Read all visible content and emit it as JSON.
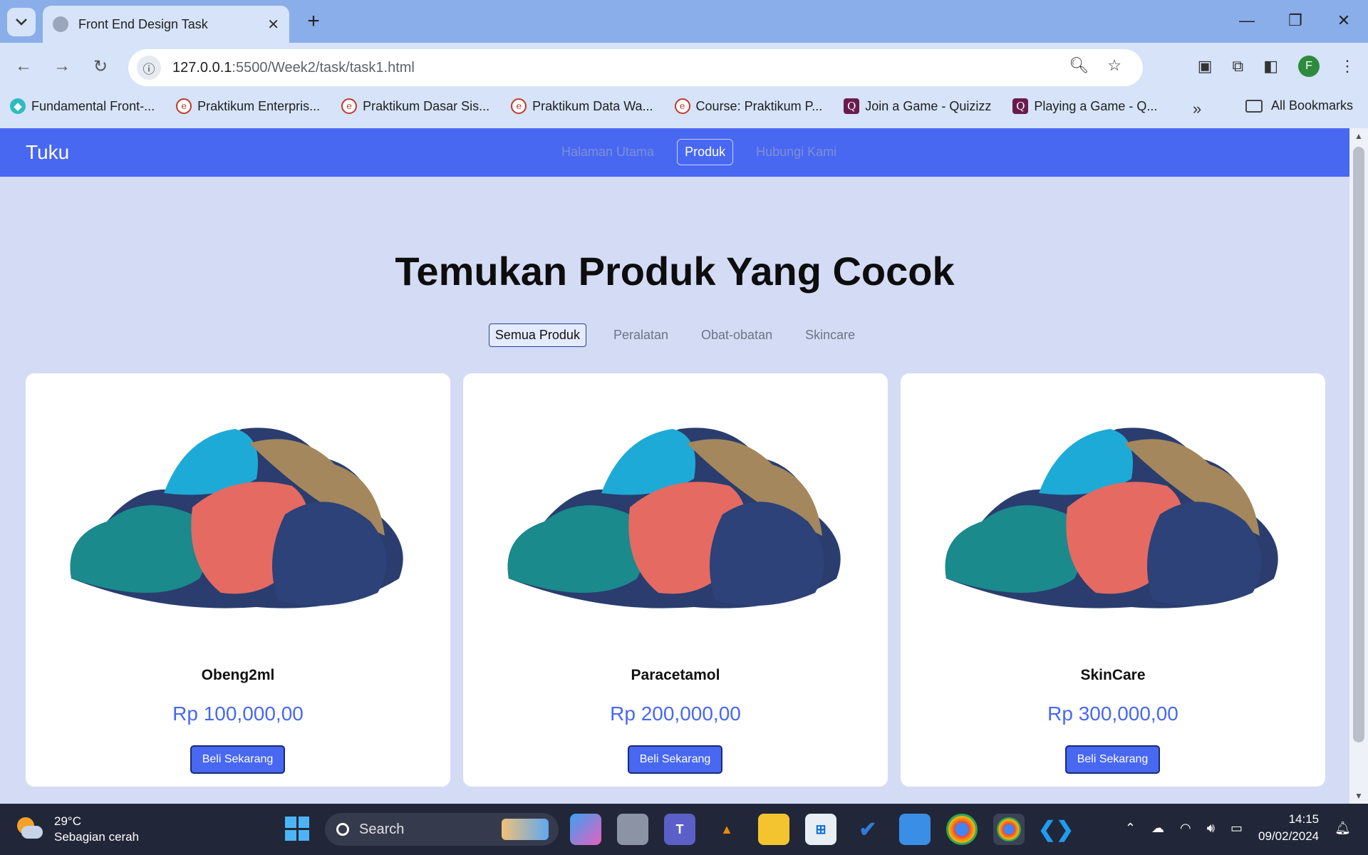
{
  "browser": {
    "tab_title": "Front End Design Task",
    "new_tab_label": "+",
    "url_host": "127.0.0.1",
    "url_path": ":5500/Week2/task/task1.html",
    "profile_initial": "F",
    "bookmarks": [
      {
        "label": "Fundamental Front-...",
        "icon": "fundamental-icon"
      },
      {
        "label": "Praktikum Enterpris...",
        "icon": "e-learning-icon"
      },
      {
        "label": "Praktikum Dasar Sis...",
        "icon": "e-learning-icon"
      },
      {
        "label": "Praktikum Data Wa...",
        "icon": "e-learning-icon"
      },
      {
        "label": "Course: Praktikum P...",
        "icon": "e-learning-icon"
      },
      {
        "label": "Join a Game - Quizizz",
        "icon": "quizizz-icon"
      },
      {
        "label": "Playing a Game - Q...",
        "icon": "quizizz-icon"
      }
    ],
    "all_bookmarks_label": "All Bookmarks"
  },
  "page": {
    "brand": "Tuku",
    "nav": [
      {
        "label": "Halaman Utama",
        "active": false
      },
      {
        "label": "Produk",
        "active": true
      },
      {
        "label": "Hubungi Kami",
        "active": false
      }
    ],
    "title": "Temukan Produk Yang Cocok",
    "filters": [
      {
        "label": "Semua Produk",
        "active": true
      },
      {
        "label": "Peralatan",
        "active": false
      },
      {
        "label": "Obat-obatan",
        "active": false
      },
      {
        "label": "Skincare",
        "active": false
      }
    ],
    "products": [
      {
        "name": "Obeng2ml",
        "price": "Rp 100,000,00",
        "button": "Beli Sekarang"
      },
      {
        "name": "Paracetamol",
        "price": "Rp 200,000,00",
        "button": "Beli Sekarang"
      },
      {
        "name": "SkinCare",
        "price": "Rp 300,000,00",
        "button": "Beli Sekarang"
      }
    ]
  },
  "taskbar": {
    "temperature": "29°C",
    "weather": "Sebagian cerah",
    "search_label": "Search",
    "time": "14:15",
    "date": "09/02/2024"
  },
  "colors": {
    "navbar": "#4868f2",
    "page_background": "#d4dbf5",
    "price": "#4868f2"
  }
}
